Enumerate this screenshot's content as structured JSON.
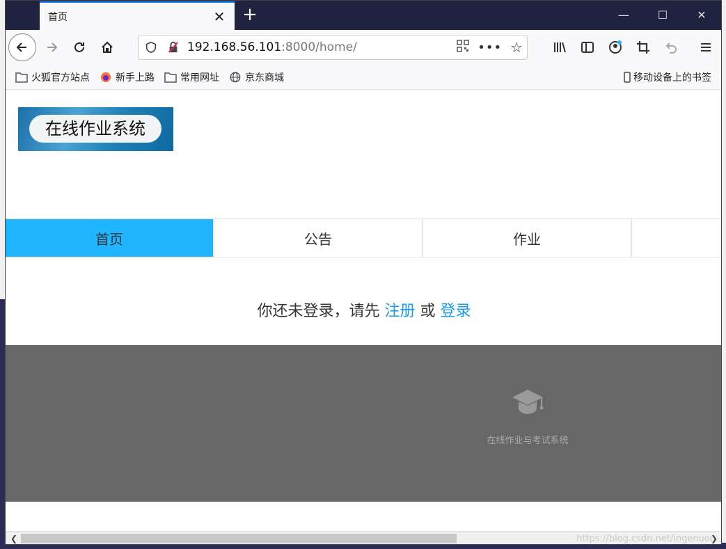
{
  "browser": {
    "tab_title": "首页",
    "url_host": "192.168.56.101",
    "url_path": ":8000/home/"
  },
  "bookmarks": [
    {
      "label": "火狐官方站点",
      "icon": "folder-icon"
    },
    {
      "label": "新手上路",
      "icon": "firefox-icon"
    },
    {
      "label": "常用网址",
      "icon": "folder-icon"
    },
    {
      "label": "京东商城",
      "icon": "globe-icon"
    }
  ],
  "mobile_bookmarks": "移动设备上的书签",
  "site": {
    "logo_text": "在线作业系统",
    "nav": [
      "首页",
      "公告",
      "作业"
    ],
    "login_prefix": "你还未登录，请先",
    "register_link": "注册",
    "or_text": "或",
    "login_link": "登录",
    "footer_text": "在线作业与考试系统"
  },
  "watermark": "https://blog.csdn.net/ingenuou",
  "colors": {
    "accent": "#1fb5ff",
    "link": "#1a9be6",
    "footer": "#676767"
  }
}
